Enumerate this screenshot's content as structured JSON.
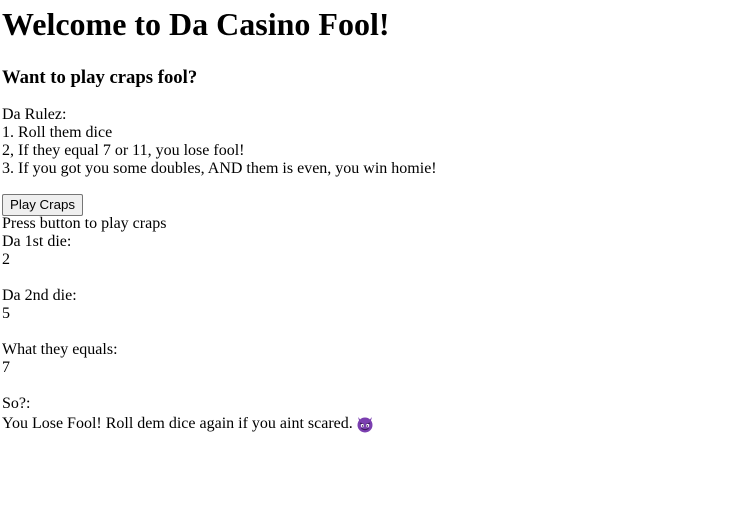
{
  "page": {
    "title": "Welcome to Da Casino Fool!",
    "subtitle": "Want to play craps fool?"
  },
  "rules": {
    "heading": "Da Rulez:",
    "items": [
      "1. Roll them dice",
      "2, If they equal 7 or 11, you lose fool!",
      "3. If you got you some doubles, AND them is even, you win homie!"
    ]
  },
  "controls": {
    "play_button_label": "Play Craps",
    "instruction": "Press button to play craps"
  },
  "results": {
    "die1_label": "Da 1st die:",
    "die1_value": "2",
    "die2_label": "Da 2nd die:",
    "die2_value": "5",
    "sum_label": "What they equals:",
    "sum_value": "7",
    "verdict_label": "So?:",
    "verdict_text": "You Lose Fool! Roll dem dice again if you aint scared.",
    "verdict_icon": "smiling-imp-emoji-icon"
  },
  "colors": {
    "imp_purple": "#7b3fb0",
    "imp_dark": "#3a1a5a"
  }
}
